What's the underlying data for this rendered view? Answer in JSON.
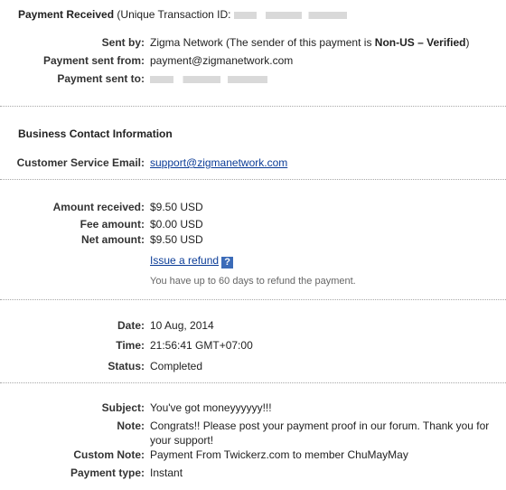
{
  "header": {
    "title": "Payment Received",
    "transaction_prefix": "(Unique Transaction ID:"
  },
  "sender": {
    "sent_by_label": "Sent by:",
    "sent_by_name": "Zigma Network",
    "sent_by_note_prefix": "(The sender of this payment is",
    "sent_by_status": "Non-US – Verified",
    "sent_by_note_suffix": ")",
    "from_label": "Payment sent from:",
    "from_value": "payment@zigmanetwork.com",
    "to_label": "Payment sent to:"
  },
  "business": {
    "heading": "Business Contact Information",
    "email_label": "Customer Service Email:",
    "email_value": "support@zigmanetwork.com"
  },
  "amounts": {
    "received_label": "Amount received:",
    "received_value": "$9.50 USD",
    "fee_label": "Fee amount:",
    "fee_value": "$0.00 USD",
    "net_label": "Net amount:",
    "net_value": "$9.50 USD",
    "refund_link": "Issue a refund",
    "refund_help": "?",
    "refund_note": "You have up to 60 days to refund the payment."
  },
  "details": {
    "date_label": "Date:",
    "date_value": "10 Aug, 2014",
    "time_label": "Time:",
    "time_value": "21:56:41 GMT+07:00",
    "status_label": "Status:",
    "status_value": "Completed"
  },
  "message": {
    "subject_label": "Subject:",
    "subject_value": "You've got moneyyyyyy!!!",
    "note_label": "Note:",
    "note_value": "Congrats!! Please post your payment proof in our forum. Thank you for your support!",
    "custom_note_label": "Custom Note:",
    "custom_note_value": "Payment From Twickerz.com to member ChuMayMay",
    "payment_type_label": "Payment type:",
    "payment_type_value": "Instant"
  }
}
